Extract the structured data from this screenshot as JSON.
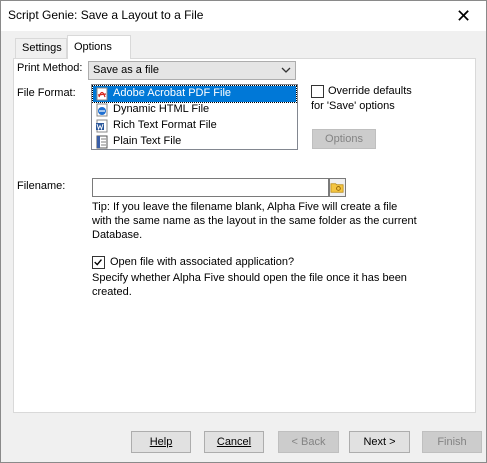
{
  "window": {
    "title": "Script Genie:  Save a Layout to a File",
    "close_glyph": "✕"
  },
  "tabs": [
    {
      "label": "Settings",
      "active": false
    },
    {
      "label": "Options",
      "active": true
    }
  ],
  "print_method": {
    "label": "Print Method:",
    "value": "Save as a file"
  },
  "file_format": {
    "label": "File Format:",
    "items": [
      {
        "label": "Adobe Acrobat PDF File",
        "icon": "pdf-file-icon",
        "selected": true
      },
      {
        "label": "Dynamic HTML File",
        "icon": "html-file-icon",
        "selected": false
      },
      {
        "label": "Rich Text Format File",
        "icon": "word-file-icon",
        "selected": false
      },
      {
        "label": "Plain Text File",
        "icon": "text-file-icon",
        "selected": false
      }
    ]
  },
  "override": {
    "label_line1": "Override defaults",
    "label_line2": "for 'Save' options",
    "checked": false,
    "options_button": "Options"
  },
  "filename": {
    "label": "Filename:",
    "value": "",
    "tip_line1": "Tip: If you leave the filename blank, Alpha Five will create a file",
    "tip_line2": "with the same name as the layout in the same folder as the current",
    "tip_line3": "Database."
  },
  "open_file": {
    "label": "Open file with associated application?",
    "checked": true,
    "desc_line1": "Specify whether Alpha Five should open the file once it has been",
    "desc_line2": "created."
  },
  "buttons": {
    "help": "Help",
    "cancel": "Cancel",
    "back": "< Back",
    "next": "Next >",
    "finish": "Finish"
  },
  "colors": {
    "selection": "#0078d7",
    "pdf_red": "#d4261c",
    "html_blue": "#1f6fd1"
  }
}
